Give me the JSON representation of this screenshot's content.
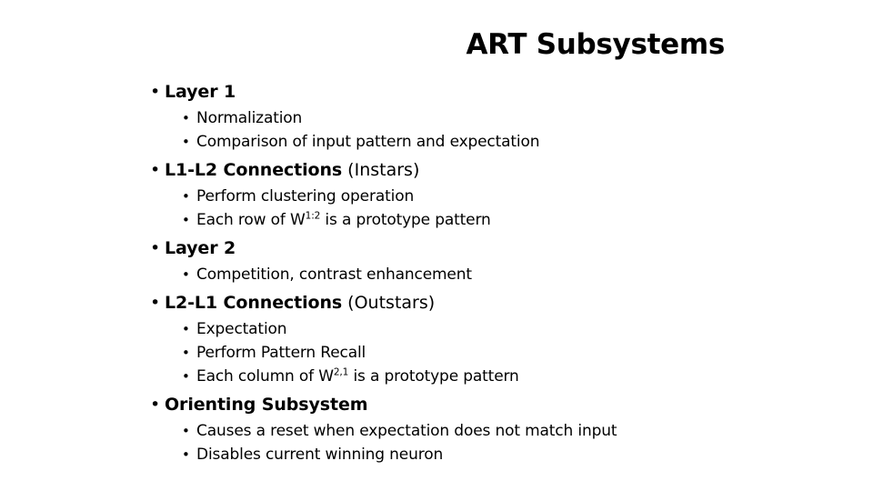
{
  "slide": {
    "title": "ART Subsystems",
    "bullet_glyph": "•",
    "text_color": "#000000",
    "background_color": "#ffffff",
    "sections": [
      {
        "heading_bold": "Layer 1",
        "heading_rest": "",
        "items": [
          {
            "pre": "Normalization",
            "sup": "",
            "post": ""
          },
          {
            "pre": "Comparison of input pattern and expectation",
            "sup": "",
            "post": ""
          }
        ]
      },
      {
        "heading_bold": "L1-L2 Connections",
        "heading_rest": " (Instars)",
        "items": [
          {
            "pre": "Perform clustering operation",
            "sup": "",
            "post": ""
          },
          {
            "pre": "Each row of W",
            "sup": "1:2",
            "post": " is a prototype pattern"
          }
        ]
      },
      {
        "heading_bold": "Layer 2",
        "heading_rest": "",
        "items": [
          {
            "pre": "Competition, contrast enhancement",
            "sup": "",
            "post": ""
          }
        ]
      },
      {
        "heading_bold": "L2-L1 Connections",
        "heading_rest": " (Outstars)",
        "items": [
          {
            "pre": "Expectation",
            "sup": "",
            "post": ""
          },
          {
            "pre": "Perform Pattern Recall",
            "sup": "",
            "post": ""
          },
          {
            "pre": "Each column of W",
            "sup": "2,1",
            "post": " is a prototype pattern"
          }
        ]
      },
      {
        "heading_bold": "Orienting Subsystem",
        "heading_rest": "",
        "items": [
          {
            "pre": "Causes a reset when expectation does not match input",
            "sup": "",
            "post": ""
          },
          {
            "pre": "Disables current winning neuron",
            "sup": "",
            "post": ""
          }
        ]
      }
    ]
  }
}
